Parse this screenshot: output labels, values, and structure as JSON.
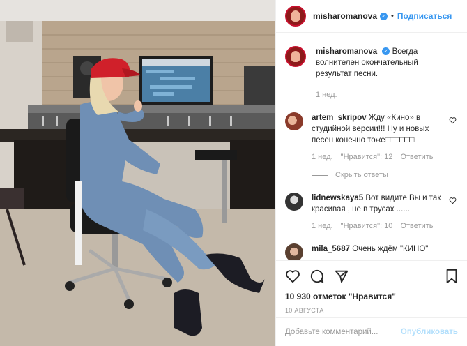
{
  "post": {
    "username": "misharomanova",
    "follow_label": "Подписаться",
    "separator": "•",
    "caption": "Всегда волнителен окончательный результат песни.",
    "caption_time": "1 нед."
  },
  "comments": [
    {
      "username": "artem_skripov",
      "text": "Жду «Кино» в студийной версии!!! Ну и новых песен конечно тоже□□□□□□",
      "time": "1 нед.",
      "likes": "\"Нравится\": 12",
      "reply": "Ответить",
      "view_replies": "Скрыть ответы"
    },
    {
      "username": "lidnewskaya5",
      "text": "Вот видите Вы и так красивая , не в трусах ......",
      "time": "1 нед.",
      "likes": "\"Нравится\": 10",
      "reply": "Ответить"
    },
    {
      "username": "mila_5687",
      "text": "Очень ждём \"КИНО\""
    }
  ],
  "actions": {
    "likes_count": "10 930 отметок \"Нравится\"",
    "date": "10 АВГУСТА"
  },
  "add_comment": {
    "placeholder": "Добавьте комментарий...",
    "publish_label": "Опубликовать"
  },
  "colors": {
    "link": "#3897f0",
    "verified": "#3897f0",
    "publish_disabled": "#b2dffc",
    "muted": "#999999"
  }
}
